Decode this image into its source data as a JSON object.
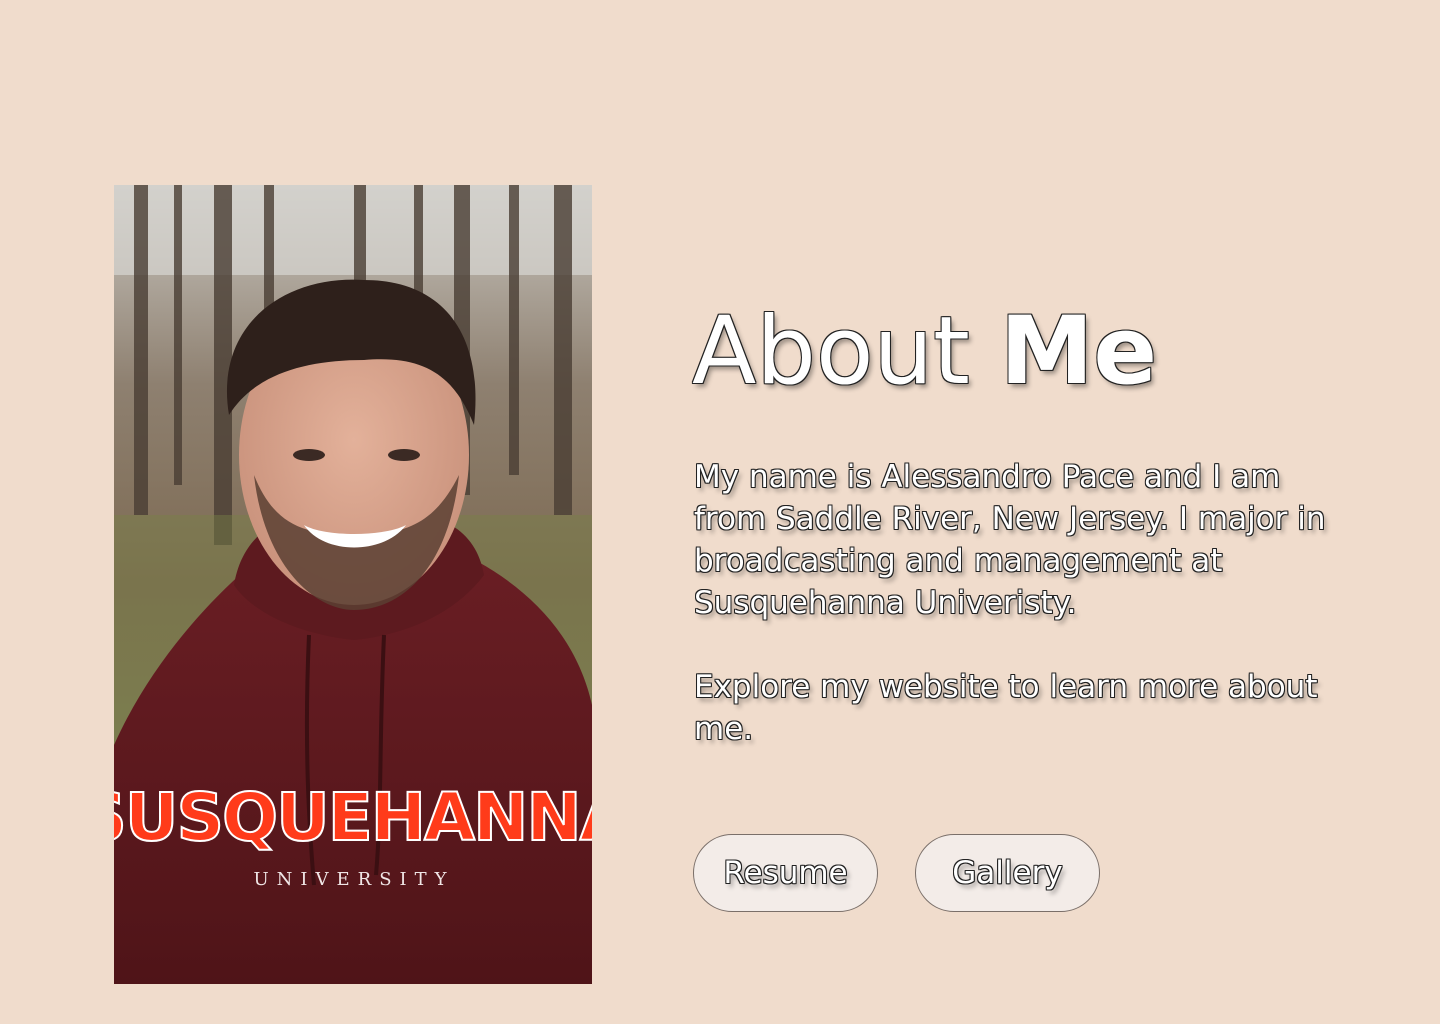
{
  "profile_photo": {
    "alt": "Smiling man in a maroon hooded sweatshirt outdoors in a wooded area",
    "sweatshirt_text": "SUSQUEHANNA",
    "sweatshirt_subtext": "UNIVERSITY"
  },
  "heading": {
    "part1": "About",
    "part2": "Me"
  },
  "bio": {
    "paragraph1": "My name is Alessandro Pace and I am from Saddle River, New Jersey. I major in broadcasting and management at Susquehanna Univeristy.",
    "paragraph2": "Explore my website to learn more about me."
  },
  "buttons": {
    "resume": "Resume",
    "gallery": "Gallery"
  },
  "colors": {
    "background": "#f0dccc",
    "button_fill": "#f3ece8",
    "text": "#ffffff",
    "text_outline": "#222222"
  }
}
